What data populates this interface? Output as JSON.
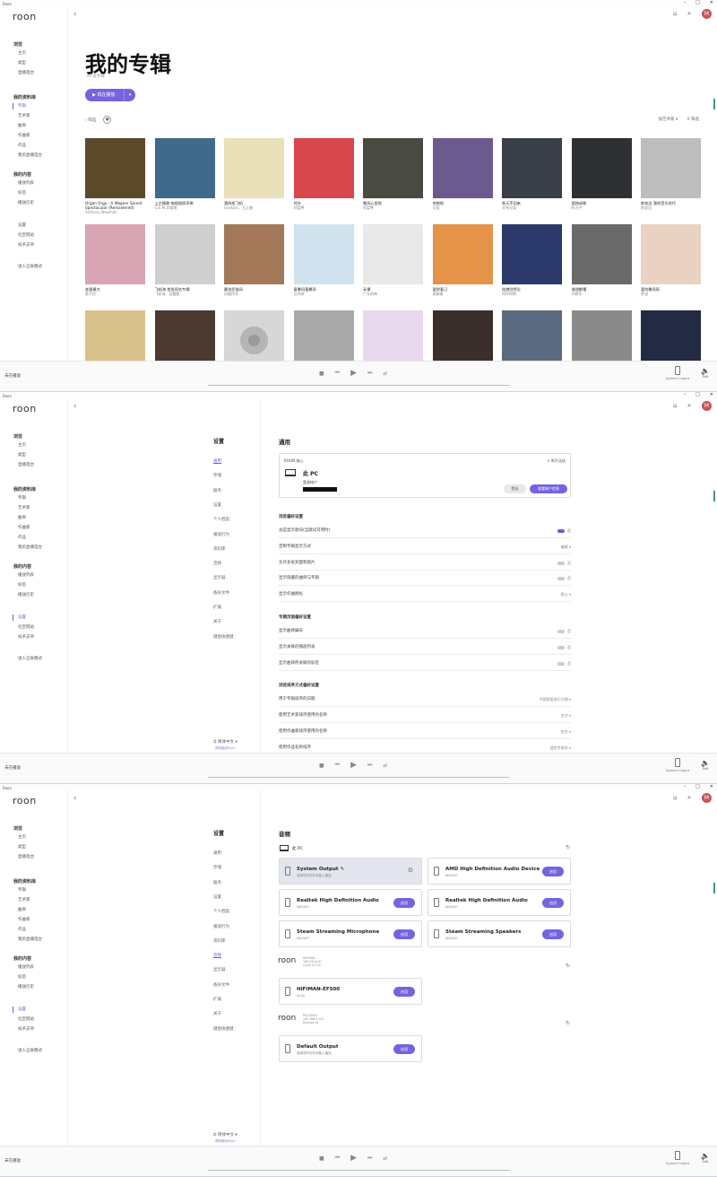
{
  "app_title": "Roon",
  "window_controls": [
    "–",
    "□",
    "✕"
  ],
  "logo": "roon",
  "sidebar": [
    {
      "header": "浏览",
      "items": [
        "主页",
        "类型",
        "直播电台"
      ]
    },
    {
      "header": "我的资料库",
      "items": [
        "专辑",
        "艺术家",
        "曲目",
        "作曲家",
        "作品",
        "我的直播电台"
      ]
    },
    {
      "header": "我的内容",
      "items": [
        "播放列表",
        "标签",
        "播放历史"
      ]
    },
    {
      "header": "",
      "items": [
        "设置",
        "社区网站",
        "技术支持"
      ]
    },
    {
      "header": "",
      "items": [
        "进入全屏模式"
      ]
    }
  ],
  "avatar_letter": "M",
  "player": {
    "now_playing": "未在播放",
    "output": "System Output",
    "volume_label": "Edit",
    "ctrl_extra": "⇄"
  },
  "albums_page": {
    "title": "我的专辑",
    "count": "39 张专辑",
    "play_button": "现在播放",
    "filter_label": "筛选",
    "sort_label": "按艺术家",
    "sort_filter": "筛选",
    "albums": [
      {
        "title": "Organ Orgy - A Wagner Sound Spectacular (Remastered)",
        "artist": "Anthony Newman",
        "color": "#5b4a2a"
      },
      {
        "title": "上古情歌 电视剧原声带",
        "artist": "G.E.M.邓紫棋",
        "color": "#3f6a8a"
      },
      {
        "title": "我的纸飞机",
        "artist": "GooGoo、王之睿",
        "color": "#e9e0b8"
      },
      {
        "title": "时针",
        "artist": "阿梨粤",
        "color": "#d9474e"
      },
      {
        "title": "晚风心里吹",
        "artist": "阿梨粤",
        "color": "#4a4a44"
      },
      {
        "title": "他他他",
        "artist": "艾辰",
        "color": "#6a5a8e"
      },
      {
        "title": "秋天不回来",
        "artist": "半吨兄弟",
        "color": "#3a3e46"
      },
      {
        "title": "孤独成歌",
        "artist": "陈天宇",
        "color": "#2f3033"
      },
      {
        "title": "陈奕迅 我的音乐时代",
        "artist": "陈奕迅",
        "color": "#bdbdbd"
      },
      {
        "title": "老婆最大",
        "artist": "蔡子恒",
        "color": "#d8a5b5"
      },
      {
        "title": "飞轮海 首张同名专辑",
        "artist": "飞轮海、田馥甄",
        "color": "#cfcfcf"
      },
      {
        "title": "最炫民族风",
        "artist": "凤凰传奇",
        "color": "#a3795a"
      },
      {
        "title": "意暴风蓬暴雨",
        "artist": "范玮琪",
        "color": "#cfe2ee"
      },
      {
        "title": "无惧",
        "artist": "广东雨神",
        "color": "#e9e9e9"
      },
      {
        "title": "爱财爱己",
        "artist": "黄静美",
        "color": "#e6934a"
      },
      {
        "title": "姑娘别哭泣",
        "artist": "柯柯柯啊",
        "color": "#2b3a6a"
      },
      {
        "title": "道理都懂",
        "artist": "刘德华",
        "color": "#6a6a6a"
      },
      {
        "title": "爱的暴风雨",
        "artist": "梦涵",
        "color": "#e9d2c2"
      },
      {
        "title": "",
        "artist": "",
        "color": "#d8c08a"
      },
      {
        "title": "",
        "artist": "",
        "color": "#4a3a30"
      },
      {
        "title": "",
        "artist": "",
        "color": "#d7d7d7"
      },
      {
        "title": "",
        "artist": "",
        "color": "#a9a9a9"
      },
      {
        "title": "",
        "artist": "",
        "color": "#e8d8ee"
      },
      {
        "title": "",
        "artist": "",
        "color": "#3a2f2a"
      },
      {
        "title": "",
        "artist": "",
        "color": "#5b6a7e"
      },
      {
        "title": "",
        "artist": "",
        "color": "#8a8a8a"
      },
      {
        "title": "",
        "artist": "",
        "color": "#222a44"
      }
    ]
  },
  "settings_nav": {
    "title": "设置",
    "items": [
      "通用",
      "存储",
      "服务",
      "设置",
      "个人档案",
      "播放行为",
      "资料库",
      "音频",
      "显示器",
      "备份文件",
      "扩展",
      "关于",
      "键盘快捷键"
    ],
    "language": "简体中文",
    "help_translate": "帮助翻译Roon"
  },
  "general": {
    "title": "通用",
    "core_label": "ROON 核心",
    "core_disconnect": "断开连接",
    "pc_name": "此 PC",
    "account_label": "登录帐户",
    "logout": "登出",
    "view_account": "查看帐户信息",
    "groups": [
      {
        "title": "浏览偏好设置",
        "rows": [
          {
            "label": "总是显示歌词(当歌词可用时)",
            "value": "是",
            "toggle": true
          },
          {
            "label": "定制专辑显示方式",
            "value": "编辑"
          },
          {
            "label": "允许多张封面和图片",
            "value": "否",
            "toggle": false
          },
          {
            "label": "显示隐藏的曲目与专辑",
            "value": "否",
            "toggle": false
          },
          {
            "label": "显示作曲图标",
            "value": "默认"
          }
        ]
      },
      {
        "title": "专辑页面偏好设置",
        "rows": [
          {
            "label": "显示曲目编号",
            "value": "否",
            "toggle": false
          },
          {
            "label": "显示关联的播放列表",
            "value": "否",
            "toggle": false
          },
          {
            "label": "显示曲目所关联的标签",
            "value": "否",
            "toggle": false
          }
        ]
      },
      {
        "title": "浏览排序方式偏好设置",
        "rows": [
          {
            "label": "用于专辑排序的日期",
            "value": "专辑首版发行日期"
          },
          {
            "label": "使用艺术家排序使用的名称",
            "value": "名字"
          },
          {
            "label": "使用作曲家排序使用的名称",
            "value": "姓名"
          },
          {
            "label": "使用作品名称排序",
            "value": "使用专辑名"
          }
        ]
      }
    ]
  },
  "audio": {
    "title": "音频",
    "pc_label": "此 PC",
    "enable": "启用",
    "pc_devices": [
      {
        "name": "System Output",
        "sub": "音频将所在的设备上播放。",
        "selected": true
      },
      {
        "name": "AMD High Definition Audio Device",
        "sub": "WASAPI"
      },
      {
        "name": "Realtek High Definition Audio",
        "sub": "WASAPI"
      },
      {
        "name": "Realtek High Definition Audio",
        "sub": "WASAPI"
      },
      {
        "name": "Steam Streaming Microphone",
        "sub": "WASAPI"
      },
      {
        "name": "Steam Streaming Speakers",
        "sub": "WASAPI"
      }
    ],
    "remote1": {
      "logo": "roon",
      "lines": [
        "HIFIMAN",
        "169.254.8.47",
        "Linux 4.3.32"
      ],
      "device": "HIFIMAN-EF500",
      "sub": "ALSA"
    },
    "remote2": {
      "logo": "roon",
      "lines": [
        "PEZ-AN54",
        "192.168.0.241",
        "Android 14"
      ],
      "device": "Default Output",
      "sub": "音频将所在的设备上播放。"
    }
  }
}
